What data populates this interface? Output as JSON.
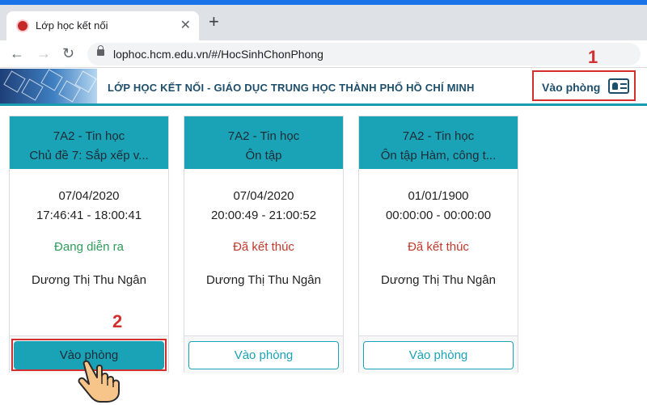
{
  "browser": {
    "tab_title": "Lớp học kết nối",
    "url": "lophoc.hcm.edu.vn/#/HocSinhChonPhong",
    "new_tab": "+",
    "close_tab": "✕"
  },
  "header": {
    "title": "LỚP HỌC KẾT NỐI -  GIÁO DỤC TRUNG HỌC THÀNH PHỐ HỒ CHÍ MINH",
    "room_button_label": "Vào phòng"
  },
  "callouts": {
    "first": "1",
    "second": "2"
  },
  "colors": {
    "accent": "#1aa3b7",
    "status_live": "#2e9d5b",
    "status_ended": "#c0392b",
    "annotation": "#d32f2f"
  },
  "rooms": [
    {
      "class_name": "7A2 - Tin học",
      "topic": "Chủ đề 7: Sắp xếp v...",
      "date": "07/04/2020",
      "time": "17:46:41 - 18:00:41",
      "status": "Đang diễn ra",
      "teacher": "Dương Thị Thu Ngân",
      "button_label": "Vào phòng"
    },
    {
      "class_name": "7A2 - Tin học",
      "topic": "Ôn tập",
      "date": "07/04/2020",
      "time": "20:00:49 - 21:00:52",
      "status": "Đã kết thúc",
      "teacher": "Dương Thị Thu Ngân",
      "button_label": "Vào phòng"
    },
    {
      "class_name": "7A2 - Tin học",
      "topic": "Ôn tập Hàm, công t...",
      "date": "01/01/1900",
      "time": "00:00:00 - 00:00:00",
      "status": "Đã kết thúc",
      "teacher": "Dương Thị Thu Ngân",
      "button_label": "Vào phòng"
    }
  ]
}
